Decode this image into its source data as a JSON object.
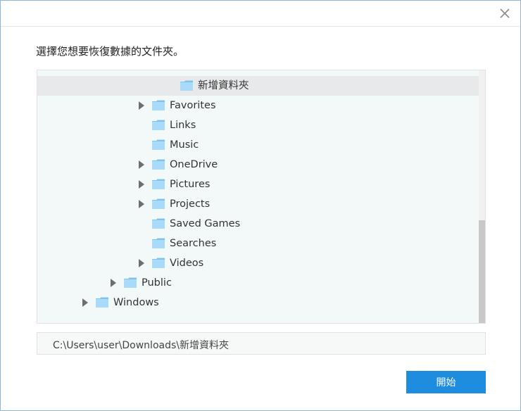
{
  "dialog": {
    "close_icon": "close-icon",
    "prompt": "選擇您想要恢復數據的文件夾。",
    "start_label": "開始",
    "path": "C:\\Users\\user\\Downloads\\新增資料夾",
    "colors": {
      "accent": "#1e8cdf",
      "tree_bg": "#f3f9f8",
      "folder": "#7cc3f0"
    }
  },
  "tree": {
    "items": [
      {
        "label": "新增資料夾",
        "expandable": false,
        "selected": true
      },
      {
        "label": "Favorites",
        "expandable": true,
        "selected": false
      },
      {
        "label": "Links",
        "expandable": false,
        "selected": false
      },
      {
        "label": "Music",
        "expandable": false,
        "selected": false
      },
      {
        "label": "OneDrive",
        "expandable": true,
        "selected": false
      },
      {
        "label": "Pictures",
        "expandable": true,
        "selected": false
      },
      {
        "label": "Projects",
        "expandable": true,
        "selected": false
      },
      {
        "label": "Saved Games",
        "expandable": false,
        "selected": false
      },
      {
        "label": "Searches",
        "expandable": false,
        "selected": false
      },
      {
        "label": "Videos",
        "expandable": true,
        "selected": false
      },
      {
        "label": "Public",
        "expandable": true,
        "selected": false
      },
      {
        "label": "Windows",
        "expandable": true,
        "selected": false
      }
    ]
  }
}
